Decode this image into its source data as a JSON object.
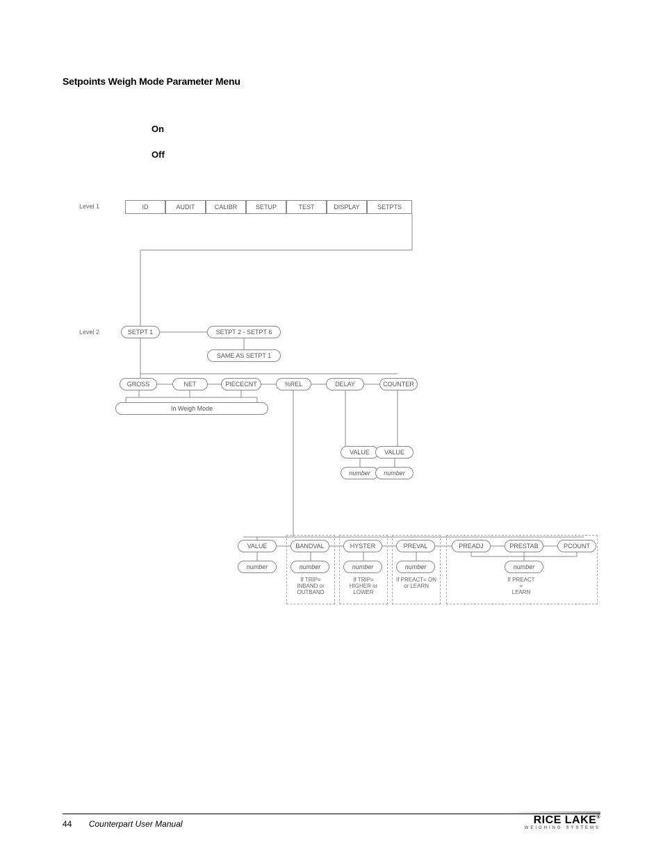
{
  "section_title": "Setpoints Weigh Mode Parameter Menu",
  "toggle": {
    "on": "On",
    "off": "Off"
  },
  "labels": {
    "level1": "Level 1",
    "level2": "Level 2"
  },
  "menu_level1": [
    "ID",
    "AUDIT",
    "CALIBR",
    "SETUP",
    "TEST",
    "DISPLAY",
    "SETPTS"
  ],
  "level2": {
    "setpt1": "SETPT 1",
    "setpt_range": "SETPT 2 - SETPT 6",
    "same_as": "SAME AS SETPT 1"
  },
  "row3": {
    "gross": "GROSS",
    "net": "NET",
    "piececnt": "PIECECNT",
    "pctrel": "%REL",
    "delay": "DELAY",
    "counter": "COUNTER",
    "in_weigh": "In Weigh Mode"
  },
  "delay_branch": {
    "value": "VALUE",
    "number": "number"
  },
  "counter_branch": {
    "value": "VALUE",
    "number": "number"
  },
  "pctrel_row": {
    "value": "VALUE",
    "value_num": "number",
    "bandval": "BANDVAL",
    "bandval_num": "number",
    "hyster": "HYSTER",
    "hyster_num": "number",
    "preval": "PREVAL",
    "preval_num": "number",
    "preadj": "PREADJ",
    "prestab": "PRESTAB",
    "pcount": "PCOUNT",
    "preadj_num": "number"
  },
  "notes": {
    "bandval": "If TRIP= INBAND or OUTBAND",
    "hyster": "If TRIP= HIGHER or LOWER",
    "preval": "If PREACT= ON or LEARN",
    "pregroup": "If PREACT\n=\nLEARN"
  },
  "footer": {
    "page": "44",
    "title": "Counterpart User Manual",
    "logo_main": "RICE LAKE",
    "logo_sub": "WEIGHING SYSTEMS"
  }
}
